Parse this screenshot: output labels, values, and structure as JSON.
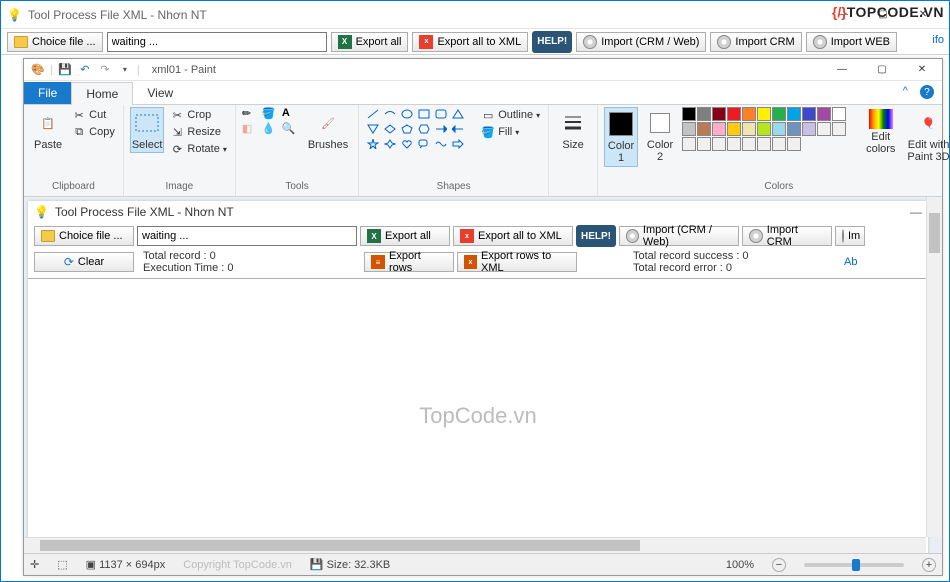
{
  "outer": {
    "title": "Tool Process File XML - Nhơn NT",
    "toolbar": {
      "choice_file": "Choice file ...",
      "waiting": "waiting ...",
      "export_all": "Export all",
      "export_all_xml": "Export all to XML",
      "help": "HELP!",
      "import_crm_web": "Import (CRM / Web)",
      "import_crm": "Import CRM",
      "import_web": "Import WEB"
    },
    "info_link": "ifo"
  },
  "paint": {
    "title": "xml01 - Paint",
    "tabs": {
      "file": "File",
      "home": "Home",
      "view": "View"
    },
    "groups": {
      "clipboard": {
        "label": "Clipboard",
        "paste": "Paste",
        "cut": "Cut",
        "copy": "Copy"
      },
      "image": {
        "label": "Image",
        "select": "Select",
        "crop": "Crop",
        "resize": "Resize",
        "rotate": "Rotate"
      },
      "tools": {
        "label": "Tools",
        "brushes": "Brushes"
      },
      "shapes": {
        "label": "Shapes",
        "outline": "Outline",
        "fill": "Fill"
      },
      "size": {
        "label": "",
        "size": "Size"
      },
      "colors": {
        "label": "Colors",
        "color1": "Color\n1",
        "color2": "Color\n2",
        "edit": "Edit\ncolors",
        "paint3d": "Edit with\nPaint 3D"
      }
    },
    "palette_row1": [
      "#000000",
      "#7f7f7f",
      "#880015",
      "#ed1c24",
      "#ff7f27",
      "#fff200",
      "#22b14c",
      "#00a2e8",
      "#3f48cc",
      "#a349a4"
    ],
    "palette_row2": [
      "#ffffff",
      "#c3c3c3",
      "#b97a57",
      "#ffaec9",
      "#ffc90e",
      "#efe4b0",
      "#b5e61d",
      "#99d9ea",
      "#7092be",
      "#c8bfe7"
    ],
    "palette_row3": [
      "#f0f0f0",
      "#f0f0f0",
      "#f0f0f0",
      "#f0f0f0",
      "#f0f0f0",
      "#f0f0f0",
      "#f0f0f0",
      "#f0f0f0",
      "#f0f0f0",
      "#f0f0f0"
    ],
    "status": {
      "pos_icon": "+",
      "dims": "1137 × 694px",
      "size": "Size: 32.3KB",
      "zoom": "100%",
      "copyright": "Copyright TopCode.vn"
    }
  },
  "inner": {
    "title": "Tool Process File XML - Nhơn NT",
    "choice_file": "Choice file ...",
    "clear": "Clear",
    "waiting": "waiting ...",
    "total_record": "Total record : 0",
    "execution_time": "Execution Time : 0",
    "export_all": "Export all",
    "export_rows": "Export rows",
    "export_all_xml": "Export all to XML",
    "export_rows_xml": "Export rows to XML",
    "help": "HELP!",
    "import_crm_web": "Import (CRM / Web)",
    "import_crm": "Import CRM",
    "import_x": "Im",
    "success": "Total record success : 0",
    "error": "Total record error : 0",
    "about": "Ab"
  },
  "watermark": "TopCode.vn",
  "logo": {
    "brace": "{/}",
    "text": "TOPCODE.VN"
  }
}
